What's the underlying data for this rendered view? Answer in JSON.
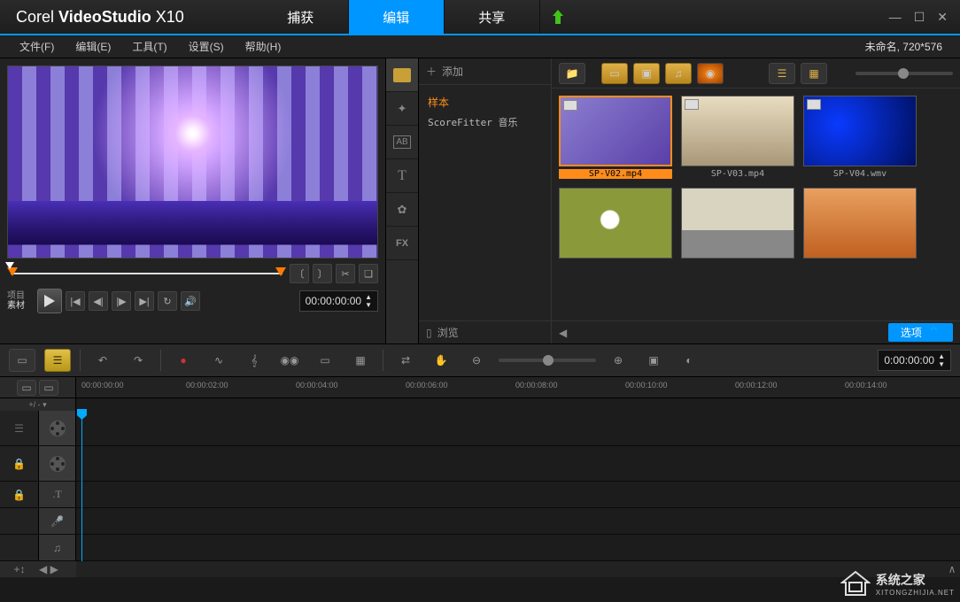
{
  "app": {
    "brand_a": "Corel",
    "brand_b": "VideoStudio",
    "brand_c": "X10"
  },
  "main_tabs": {
    "capture": "捕获",
    "edit": "编辑",
    "share": "共享"
  },
  "menu": {
    "file": "文件(F)",
    "edit": "编辑(E)",
    "tools": "工具(T)",
    "settings": "设置(S)",
    "help": "帮助(H)"
  },
  "project": {
    "name": "未命名",
    "resolution": "720*576"
  },
  "preview": {
    "label_project": "项目",
    "label_clip": "素材",
    "timecode": "00:00:00:00"
  },
  "library": {
    "add": "添加",
    "tree_sample": "样本",
    "tree_scorefitter": "ScoreFitter 音乐",
    "browse": "浏览",
    "options": "选项",
    "thumbs": [
      {
        "label": "SP-V02.mp4"
      },
      {
        "label": "SP-V03.mp4"
      },
      {
        "label": "SP-V04.wmv"
      },
      {
        "label": ""
      },
      {
        "label": ""
      },
      {
        "label": ""
      }
    ]
  },
  "side_tabs": {
    "ab": "AB",
    "t": "T",
    "fx": "FX"
  },
  "timeline": {
    "marks": [
      "00:00:00:00",
      "00:00:02:00",
      "00:00:04:00",
      "00:00:06:00",
      "00:00:08:00",
      "00:00:10:00",
      "00:00:12:00",
      "00:00:14:00"
    ],
    "tc": "0:00:00:00",
    "plus": "+/ - ▾"
  },
  "watermark": {
    "title": "系统之家",
    "url": "XITONGZHIJIA.NET"
  }
}
